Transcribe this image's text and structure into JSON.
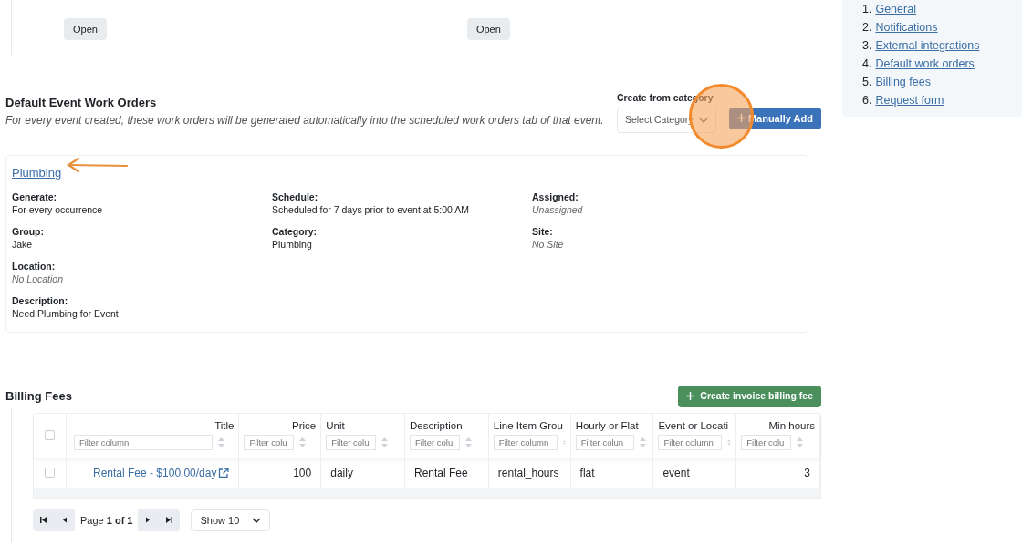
{
  "top_buttons": [
    "Open",
    "Open"
  ],
  "toc": [
    {
      "number": "1.",
      "label": "General"
    },
    {
      "number": "2.",
      "label": "Notifications"
    },
    {
      "number": "3.",
      "label": "External integrations"
    },
    {
      "number": "4.",
      "label": "Default work orders"
    },
    {
      "number": "5.",
      "label": "Billing fees"
    },
    {
      "number": "6.",
      "label": "Request form"
    }
  ],
  "work_orders": {
    "title": "Default Event Work Orders",
    "subtitle": "For every event created, these work orders will be generated automatically into the scheduled work orders tab of that event.",
    "create_label": "Create from category",
    "select_placeholder": "Select Category",
    "add_button": "Manually Add",
    "cards": [
      {
        "title": "Plumbing",
        "columns": [
          [
            {
              "label": "Generate:",
              "value": "For every occurrence",
              "muted": false
            },
            {
              "label": "Group:",
              "value": "Jake",
              "muted": false
            },
            {
              "label": "Location:",
              "value": "No Location",
              "muted": true
            },
            {
              "label": "Description:",
              "value": "Need Plumbing for Event",
              "muted": false
            }
          ],
          [
            {
              "label": "Schedule:",
              "value": "Scheduled for 7 days prior to event at 5:00 AM",
              "muted": false
            },
            {
              "label": "Category:",
              "value": "Plumbing",
              "muted": false
            }
          ],
          [
            {
              "label": "Assigned:",
              "value": "Unassigned",
              "muted": true
            },
            {
              "label": "Site:",
              "value": "No Site",
              "muted": true
            }
          ]
        ]
      }
    ]
  },
  "billing": {
    "title": "Billing Fees",
    "create_button": "Create invoice billing fee",
    "table": {
      "select_all_checked": false,
      "columns": [
        {
          "label": "Title",
          "filter_placeholder": "Filter column"
        },
        {
          "label": "Price",
          "filter_placeholder": "Filter colu"
        },
        {
          "label": "Unit",
          "filter_placeholder": "Filter colu"
        },
        {
          "label": "Description",
          "filter_placeholder": "Filter colu"
        },
        {
          "label": "Line Item Grou",
          "filter_placeholder": "Filter column"
        },
        {
          "label": "Hourly or Flat",
          "filter_placeholder": "Filter colun"
        },
        {
          "label": "Event or Locati",
          "filter_placeholder": "Filter column"
        },
        {
          "label": "Min hours",
          "filter_placeholder": "Filter colu"
        }
      ],
      "rows": [
        {
          "checked": false,
          "cells": [
            "Rental Fee - $100.00/day",
            "100",
            "daily",
            "Rental Fee",
            "rental_hours",
            "flat",
            "event",
            "3"
          ]
        }
      ]
    },
    "pagination": {
      "page_text": "Page **1 of 1**",
      "page_size": "Show 10"
    }
  }
}
